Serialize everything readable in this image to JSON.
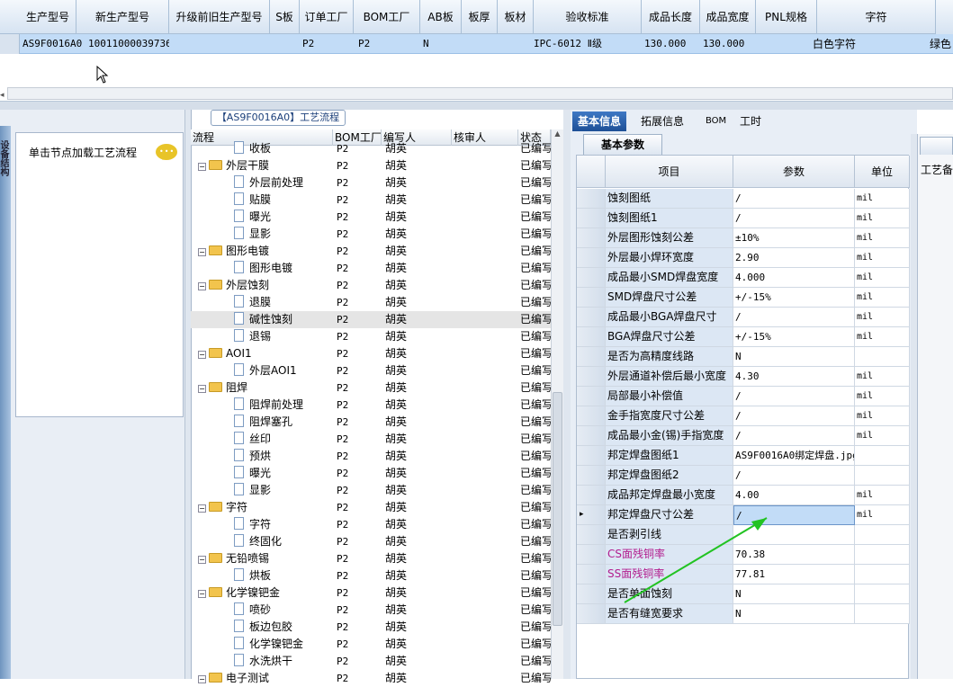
{
  "top_grid": {
    "columns": [
      "生产型号",
      "新生产型号",
      "升级前旧生产型号",
      "S板",
      "订单工厂",
      "BOM工厂",
      "AB板",
      "板厚",
      "板材",
      "验收标准",
      "成品长度",
      "成品宽度",
      "PNL规格",
      "字符"
    ],
    "row": [
      "AS9F0016A0",
      "10011000039736",
      "",
      "",
      "P2",
      "P2",
      "N",
      "",
      "",
      "IPC-6012 Ⅱ级",
      "130.000",
      "130.000",
      "",
      "白色字符"
    ],
    "row_extra": "绿色"
  },
  "left_panel": {
    "side_tab": "设备结构",
    "hint_text": "单击节点加载工艺流程"
  },
  "middle_panel": {
    "title": "【AS9F0016A0】工艺流程",
    "headers": [
      "流程",
      "BOM工厂",
      "编写人",
      "核审人",
      "状态"
    ],
    "rows": [
      {
        "level": 1,
        "type": "doc",
        "name": "收板",
        "bom": "P2",
        "author": "胡英",
        "status": "已编写"
      },
      {
        "level": 0,
        "type": "folder",
        "name": "外层干膜",
        "bom": "P2",
        "author": "胡英",
        "status": "已编写"
      },
      {
        "level": 1,
        "type": "doc",
        "name": "外层前处理",
        "bom": "P2",
        "author": "胡英",
        "status": "已编写"
      },
      {
        "level": 1,
        "type": "doc",
        "name": "贴膜",
        "bom": "P2",
        "author": "胡英",
        "status": "已编写"
      },
      {
        "level": 1,
        "type": "doc",
        "name": "曝光",
        "bom": "P2",
        "author": "胡英",
        "status": "已编写"
      },
      {
        "level": 1,
        "type": "doc",
        "name": "显影",
        "bom": "P2",
        "author": "胡英",
        "status": "已编写"
      },
      {
        "level": 0,
        "type": "folder",
        "name": "图形电镀",
        "bom": "P2",
        "author": "胡英",
        "status": "已编写"
      },
      {
        "level": 1,
        "type": "doc",
        "name": "图形电镀",
        "bom": "P2",
        "author": "胡英",
        "status": "已编写"
      },
      {
        "level": 0,
        "type": "folder",
        "name": "外层蚀刻",
        "bom": "P2",
        "author": "胡英",
        "status": "已编写"
      },
      {
        "level": 1,
        "type": "doc",
        "name": "退膜",
        "bom": "P2",
        "author": "胡英",
        "status": "已编写"
      },
      {
        "level": 1,
        "type": "doc",
        "name": "碱性蚀刻",
        "bom": "P2",
        "author": "胡英",
        "status": "已编写",
        "selected": true
      },
      {
        "level": 1,
        "type": "doc",
        "name": "退锡",
        "bom": "P2",
        "author": "胡英",
        "status": "已编写"
      },
      {
        "level": 0,
        "type": "folder",
        "name": "AOI1",
        "bom": "P2",
        "author": "胡英",
        "status": "已编写"
      },
      {
        "level": 1,
        "type": "doc",
        "name": "外层AOI1",
        "bom": "P2",
        "author": "胡英",
        "status": "已编写"
      },
      {
        "level": 0,
        "type": "folder",
        "name": "阻焊",
        "bom": "P2",
        "author": "胡英",
        "status": "已编写"
      },
      {
        "level": 1,
        "type": "doc",
        "name": "阻焊前处理",
        "bom": "P2",
        "author": "胡英",
        "status": "已编写"
      },
      {
        "level": 1,
        "type": "doc",
        "name": "阻焊塞孔",
        "bom": "P2",
        "author": "胡英",
        "status": "已编写"
      },
      {
        "level": 1,
        "type": "doc",
        "name": "丝印",
        "bom": "P2",
        "author": "胡英",
        "status": "已编写"
      },
      {
        "level": 1,
        "type": "doc",
        "name": "预烘",
        "bom": "P2",
        "author": "胡英",
        "status": "已编写"
      },
      {
        "level": 1,
        "type": "doc",
        "name": "曝光",
        "bom": "P2",
        "author": "胡英",
        "status": "已编写"
      },
      {
        "level": 1,
        "type": "doc",
        "name": "显影",
        "bom": "P2",
        "author": "胡英",
        "status": "已编写"
      },
      {
        "level": 0,
        "type": "folder",
        "name": "字符",
        "bom": "P2",
        "author": "胡英",
        "status": "已编写"
      },
      {
        "level": 1,
        "type": "doc",
        "name": "字符",
        "bom": "P2",
        "author": "胡英",
        "status": "已编写"
      },
      {
        "level": 1,
        "type": "doc",
        "name": "终固化",
        "bom": "P2",
        "author": "胡英",
        "status": "已编写"
      },
      {
        "level": 0,
        "type": "folder",
        "name": "无铅喷锡",
        "bom": "P2",
        "author": "胡英",
        "status": "已编写"
      },
      {
        "level": 1,
        "type": "doc",
        "name": "烘板",
        "bom": "P2",
        "author": "胡英",
        "status": "已编写"
      },
      {
        "level": 0,
        "type": "folder",
        "name": "化学镍钯金",
        "bom": "P2",
        "author": "胡英",
        "status": "已编写"
      },
      {
        "level": 1,
        "type": "doc",
        "name": "喷砂",
        "bom": "P2",
        "author": "胡英",
        "status": "已编写"
      },
      {
        "level": 1,
        "type": "doc",
        "name": "板边包胶",
        "bom": "P2",
        "author": "胡英",
        "status": "已编写"
      },
      {
        "level": 1,
        "type": "doc",
        "name": "化学镍钯金",
        "bom": "P2",
        "author": "胡英",
        "status": "已编写"
      },
      {
        "level": 1,
        "type": "doc",
        "name": "水洗烘干",
        "bom": "P2",
        "author": "胡英",
        "status": "已编写"
      },
      {
        "level": 0,
        "type": "folder",
        "name": "电子测试",
        "bom": "P2",
        "author": "胡英",
        "status": "已编写"
      }
    ]
  },
  "right_panel": {
    "tabs": [
      "基本信息",
      "拓展信息",
      "BOM",
      "工时"
    ],
    "sub_tab": "基本参数",
    "grid_headers": [
      "项目",
      "参数",
      "单位"
    ],
    "rows": [
      {
        "item": "蚀刻图纸",
        "value": "/",
        "unit": "mil"
      },
      {
        "item": "蚀刻图纸1",
        "value": "/",
        "unit": "mil"
      },
      {
        "item": "外层图形蚀刻公差",
        "value": "±10%",
        "unit": "mil"
      },
      {
        "item": "外层最小焊环宽度",
        "value": "2.90",
        "unit": "mil"
      },
      {
        "item": "成品最小SMD焊盘宽度",
        "value": "4.000",
        "unit": "mil"
      },
      {
        "item": "SMD焊盘尺寸公差",
        "value": "+/-15%",
        "unit": "mil"
      },
      {
        "item": "成品最小BGA焊盘尺寸",
        "value": "/",
        "unit": "mil"
      },
      {
        "item": "BGA焊盘尺寸公差",
        "value": "+/-15%",
        "unit": "mil"
      },
      {
        "item": "是否为高精度线路",
        "value": "N",
        "unit": ""
      },
      {
        "item": "外层通道补偿后最小宽度",
        "value": "4.30",
        "unit": "mil"
      },
      {
        "item": "局部最小补偿值",
        "value": "/",
        "unit": "mil"
      },
      {
        "item": "金手指宽度尺寸公差",
        "value": "/",
        "unit": "mil"
      },
      {
        "item": "成品最小金(锡)手指宽度",
        "value": "/",
        "unit": "mil"
      },
      {
        "item": "邦定焊盘图纸1",
        "value": "AS9F0016A0绑定焊盘.jpg",
        "unit": ""
      },
      {
        "item": "邦定焊盘图纸2",
        "value": "/",
        "unit": ""
      },
      {
        "item": "成品邦定焊盘最小宽度",
        "value": "4.00",
        "unit": "mil"
      },
      {
        "item": "邦定焊盘尺寸公差",
        "value": "/",
        "unit": "mil",
        "current": true
      },
      {
        "item": "是否剥引线",
        "value": "",
        "unit": ""
      },
      {
        "item": "CS面残铜率",
        "value": "70.38",
        "unit": "",
        "pink": true
      },
      {
        "item": "SS面残铜率",
        "value": "77.81",
        "unit": "",
        "pink": true
      },
      {
        "item": "是否单面蚀刻",
        "value": "N",
        "unit": ""
      },
      {
        "item": "是否有缝宽要求",
        "value": "N",
        "unit": ""
      }
    ],
    "arrow_color": "#22c322"
  },
  "far_right": {
    "label": "工艺备"
  }
}
